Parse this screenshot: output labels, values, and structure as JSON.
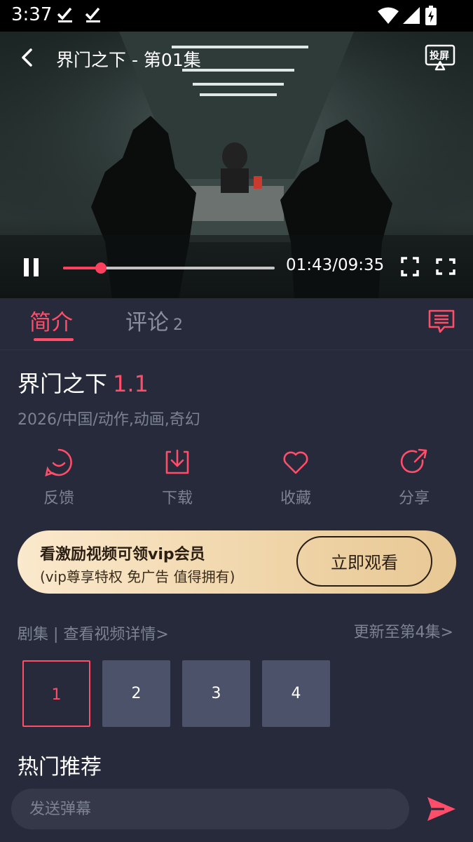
{
  "status_bar": {
    "time": "3:37"
  },
  "player": {
    "title": "界门之下 - 第01集",
    "time_display": "01:43/09:35",
    "progress_fraction": 0.18,
    "cast_label": "投屏"
  },
  "tabs": {
    "intro_label": "简介",
    "comments_label": "评论",
    "comments_count": "2"
  },
  "movie": {
    "title": "界门之下",
    "score": "1.1",
    "meta": "2026/中国/动作,动画,奇幻"
  },
  "actions": [
    {
      "label": "反馈",
      "icon": "smile-icon"
    },
    {
      "label": "下载",
      "icon": "download-icon"
    },
    {
      "label": "收藏",
      "icon": "heart-icon"
    },
    {
      "label": "分享",
      "icon": "share-icon"
    }
  ],
  "vip_banner": {
    "title": "看激励视频可领vip会员",
    "subtitle": "(vip尊享特权 免广告 值得拥有)",
    "button_label": "立即观看"
  },
  "episodes": {
    "link_label": "剧集 | 查看视频详情>",
    "update_label": "更新至第4集>",
    "items": [
      "1",
      "2",
      "3",
      "4"
    ],
    "selected": "1"
  },
  "hot": {
    "title": "热门推荐"
  },
  "danmaku": {
    "placeholder": "发送弹幕"
  },
  "colors": {
    "accent": "#ff4d6a",
    "background": "#262a3a",
    "episode_bg": "#4b5269",
    "muted_text": "#7d8291",
    "vip_gold": "#f2d9b0"
  }
}
